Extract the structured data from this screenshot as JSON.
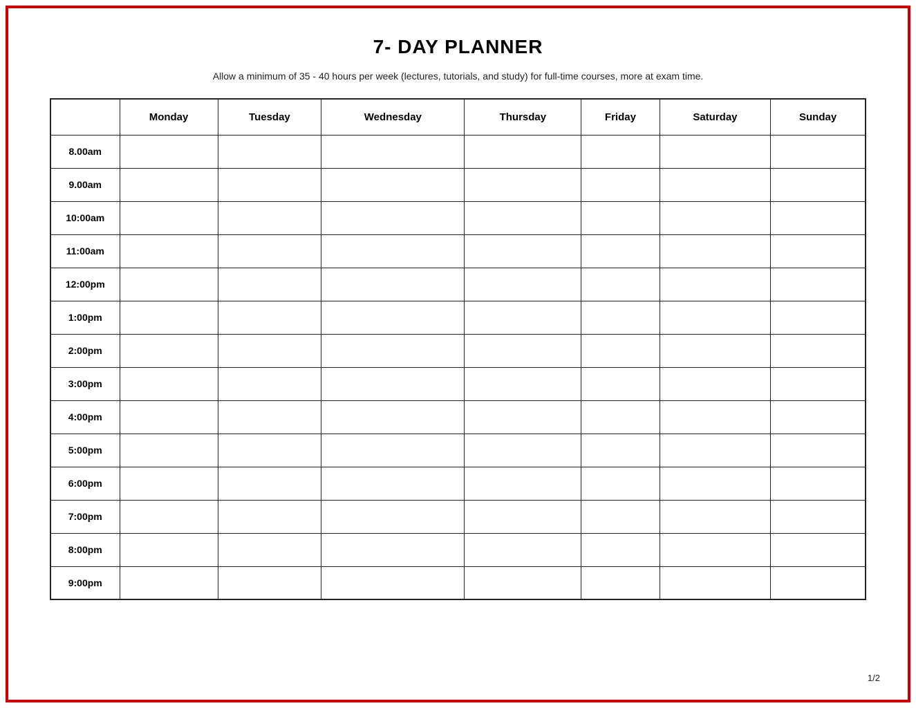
{
  "page": {
    "title": "7- DAY PLANNER",
    "subtitle": "Allow a minimum of 35 - 40 hours per week (lectures, tutorials, and study) for full-time courses, more at exam time.",
    "page_number": "1/2"
  },
  "table": {
    "headers": [
      "",
      "Monday",
      "Tuesday",
      "Wednesday",
      "Thursday",
      "Friday",
      "Saturday",
      "Sunday"
    ],
    "rows": [
      "8.00am",
      "9.00am",
      "10:00am",
      "11:00am",
      "12:00pm",
      "1:00pm",
      "2:00pm",
      "3:00pm",
      "4:00pm",
      "5:00pm",
      "6:00pm",
      "7:00pm",
      "8:00pm",
      "9:00pm"
    ]
  }
}
